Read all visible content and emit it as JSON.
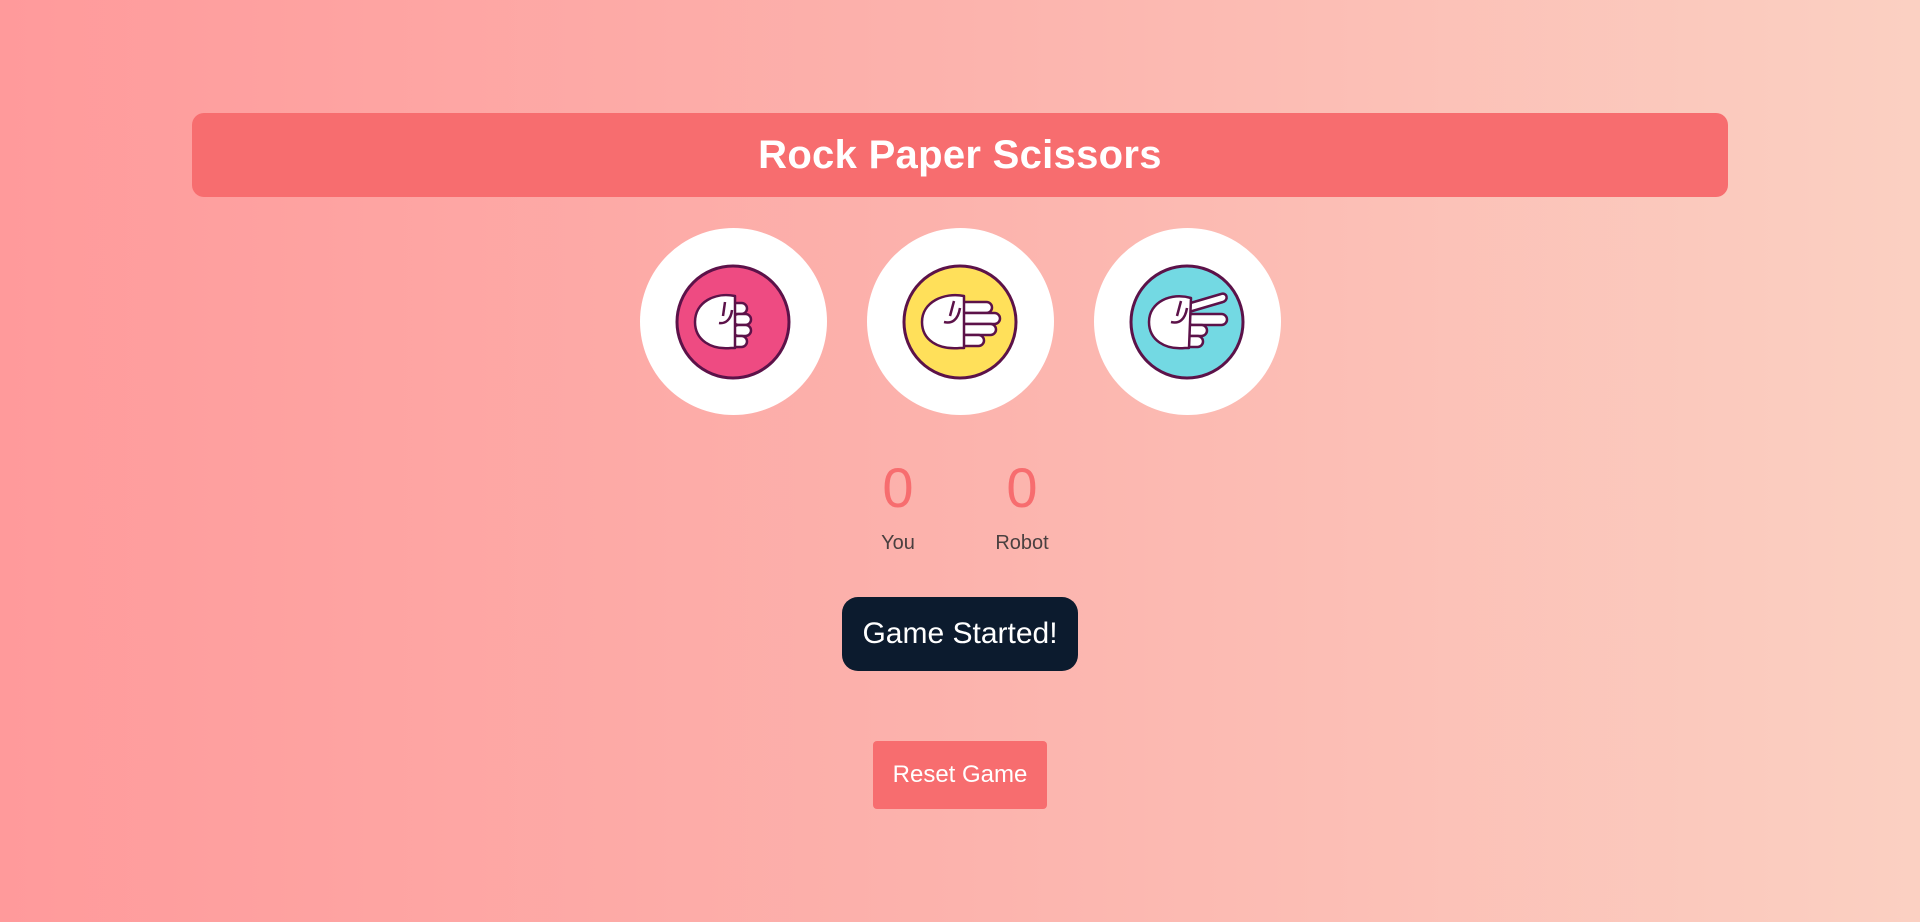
{
  "header": {
    "title": "Rock Paper Scissors"
  },
  "choices": [
    {
      "id": "rock",
      "icon": "rock-hand-icon",
      "color": "#ee4b82"
    },
    {
      "id": "paper",
      "icon": "paper-hand-icon",
      "color": "#ffe05a"
    },
    {
      "id": "scissors",
      "icon": "scissors-hand-icon",
      "color": "#73d9e3"
    }
  ],
  "scores": {
    "player": {
      "value": "0",
      "label": "You"
    },
    "robot": {
      "value": "0",
      "label": "Robot"
    }
  },
  "status": {
    "message": "Game Started!"
  },
  "reset": {
    "label": "Reset Game"
  },
  "colors": {
    "accent": "#f76d6f",
    "status_bg": "#0c1b2e",
    "outline": "#5c1249"
  }
}
